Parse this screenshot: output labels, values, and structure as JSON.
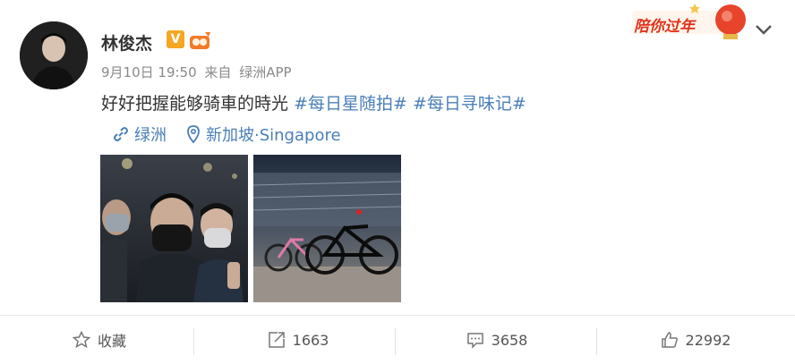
{
  "user": {
    "name": "林俊杰",
    "verified_badge": "V",
    "avatar_icon": "user-avatar"
  },
  "post": {
    "date": "9月10日 19:50",
    "source_prefix": "来自",
    "source": "绿洲APP",
    "text": "好好把握能够骑車的時光",
    "tags": [
      "#每日星随拍#",
      "#每日寻味记#"
    ],
    "links": [
      {
        "icon": "link-icon",
        "label": "绿洲"
      },
      {
        "icon": "location-pin-icon",
        "label": "新加坡·Singapore"
      }
    ],
    "photos": [
      {
        "name": "photo-selfie-group"
      },
      {
        "name": "photo-bicycles"
      }
    ]
  },
  "promo": {
    "label": "陪你过年"
  },
  "actions": [
    {
      "icon": "star-icon",
      "label": "收藏"
    },
    {
      "icon": "share-icon",
      "label": "1663"
    },
    {
      "icon": "comment-icon",
      "label": "3658"
    },
    {
      "icon": "thumbs-up-icon",
      "label": "22992"
    }
  ],
  "colors": {
    "link": "#4a7fb8",
    "meta": "#8a8a8a",
    "promo": "#e0331b"
  }
}
